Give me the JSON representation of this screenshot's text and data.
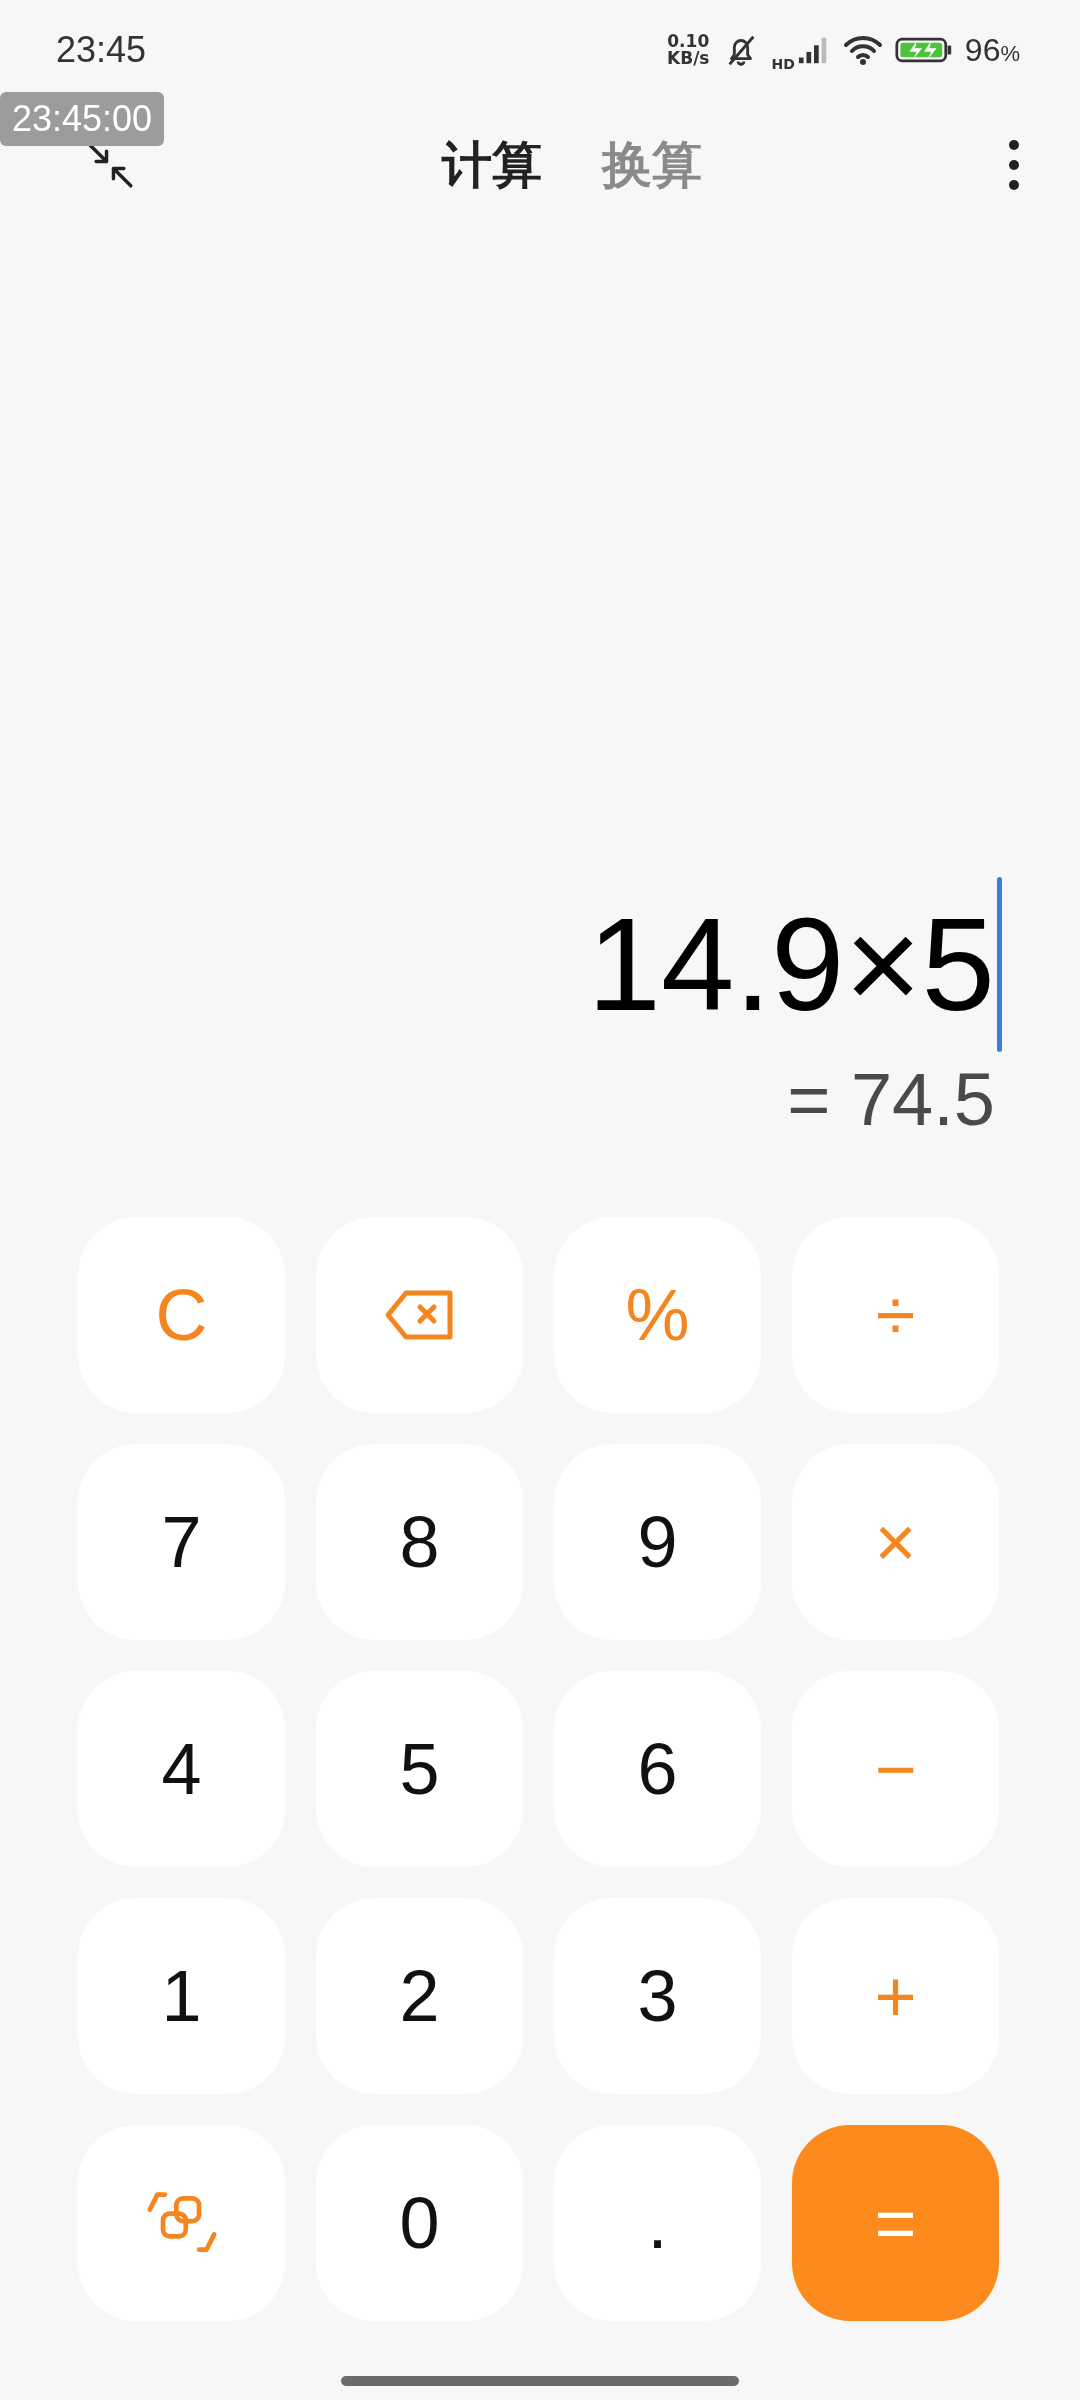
{
  "status_bar": {
    "time": "23:45",
    "net_speed": "0.10",
    "net_unit": "KB/s",
    "network": "HD",
    "battery": "96",
    "battery_unit": "%"
  },
  "overlay_clock": "23:45:00",
  "tabs": [
    {
      "label": "计算",
      "selected": true
    },
    {
      "label": "换算",
      "selected": false
    }
  ],
  "display": {
    "expression": "14.9×5",
    "result": "= 74.5"
  },
  "keys": [
    {
      "kind": "operator",
      "label": "C"
    },
    {
      "kind": "backspace"
    },
    {
      "kind": "operator",
      "label": "%"
    },
    {
      "kind": "operator",
      "label": "÷"
    },
    {
      "kind": "digit",
      "label": "7"
    },
    {
      "kind": "digit",
      "label": "8"
    },
    {
      "kind": "digit",
      "label": "9"
    },
    {
      "kind": "operator",
      "label": "×"
    },
    {
      "kind": "digit",
      "label": "4"
    },
    {
      "kind": "digit",
      "label": "5"
    },
    {
      "kind": "digit",
      "label": "6"
    },
    {
      "kind": "operator",
      "label": "−"
    },
    {
      "kind": "digit",
      "label": "1"
    },
    {
      "kind": "digit",
      "label": "2"
    },
    {
      "kind": "digit",
      "label": "3"
    },
    {
      "kind": "operator",
      "label": "+"
    },
    {
      "kind": "switch"
    },
    {
      "kind": "digit",
      "label": "0"
    },
    {
      "kind": "digit",
      "label": "."
    },
    {
      "kind": "equals",
      "label": "="
    }
  ]
}
